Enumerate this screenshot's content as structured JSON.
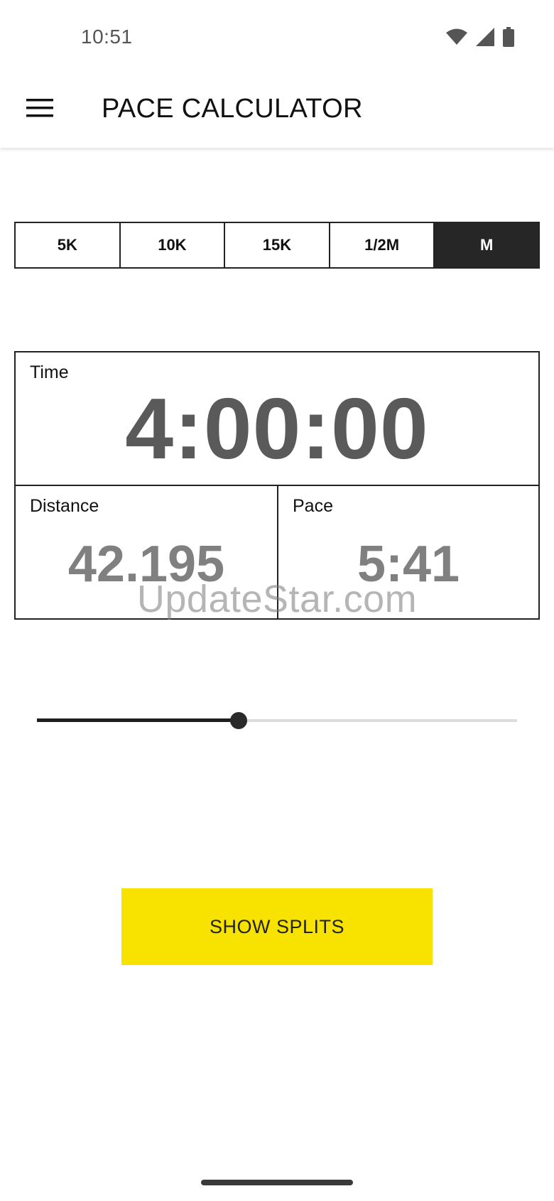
{
  "status_bar": {
    "time": "10:51",
    "icons": [
      "wifi-icon",
      "cellular-signal-icon",
      "battery-icon"
    ]
  },
  "app_bar": {
    "menu_icon": "hamburger-menu-icon",
    "title": "PACE CALCULATOR"
  },
  "distance_selector": {
    "options": [
      "5K",
      "10K",
      "15K",
      "1/2M",
      "M"
    ],
    "selected": "M"
  },
  "results": {
    "time_label": "Time",
    "time_value": "4:00:00",
    "distance_label": "Distance",
    "distance_value": "42.195",
    "pace_label": "Pace",
    "pace_value": "5:41"
  },
  "watermark": "UpdateStar.com",
  "slider": {
    "value_fraction": 0.42
  },
  "show_splits_label": "SHOW SPLITS",
  "colors": {
    "accent": "#f7e200",
    "selected_segment": "#262626",
    "value_text": "#5a5a5a"
  }
}
